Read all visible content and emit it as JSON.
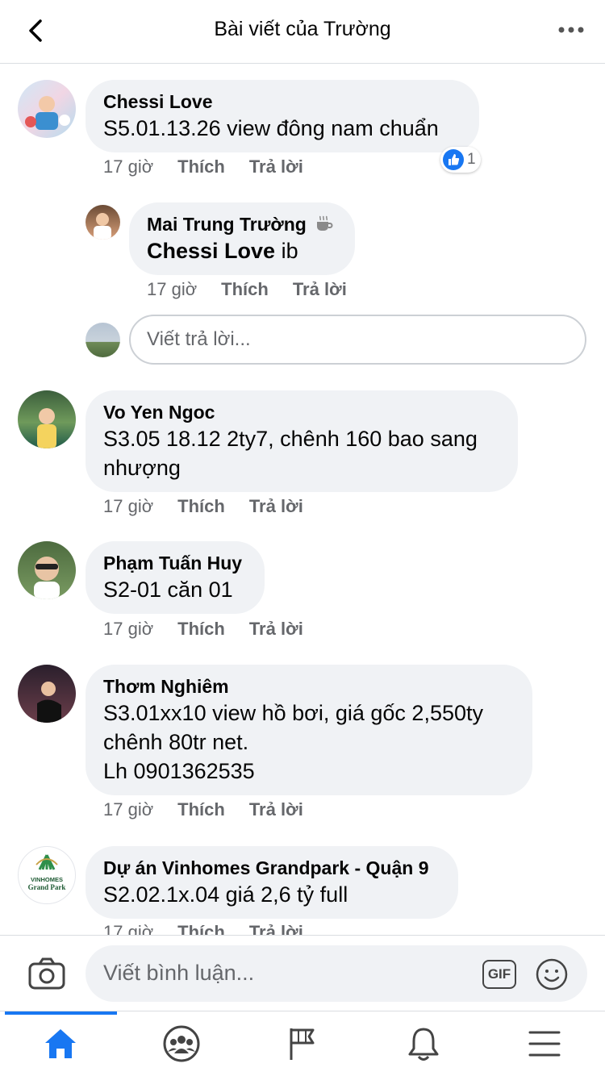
{
  "header": {
    "title": "Bài viết của Trường"
  },
  "comments": [
    {
      "name": "Chessi Love",
      "text": "S5.01.13.26 view đông nam chuẩn",
      "time": "17 giờ",
      "like": "Thích",
      "reply": "Trả lời",
      "like_count": "1"
    },
    {
      "name": "Mai Trung Trường",
      "mention": "Chessi Love",
      "text": " ib",
      "time": "17 giờ",
      "like": "Thích",
      "reply": "Trả lời"
    },
    {
      "name": "Vo Yen Ngoc",
      "text_lines": [
        "S3.05 18.12 2ty7, chênh 160 bao sang",
        "nhượng"
      ],
      "time": "17 giờ",
      "like": "Thích",
      "reply": "Trả lời"
    },
    {
      "name": "Phạm Tuấn Huy",
      "text": "S2-01 căn 01",
      "time": "17 giờ",
      "like": "Thích",
      "reply": "Trả lời"
    },
    {
      "name": "Thơm Nghiêm",
      "text_lines": [
        "S3.01xx10 view hồ bơi, giá gốc 2,550ty",
        "chênh 80tr net.",
        "Lh 0901362535"
      ],
      "time": "17 giờ",
      "like": "Thích",
      "reply": "Trả lời"
    },
    {
      "name": "Dự án Vinhomes Grandpark - Quận 9",
      "text": "S2.02.1x.04 giá 2,6 tỷ full",
      "time": "17 giờ",
      "like": "Thích",
      "reply": "Trả lời",
      "logo_text": [
        "VINHOMES",
        "Grand Park"
      ]
    }
  ],
  "reply_placeholder": "Viết trả lời...",
  "composer": {
    "placeholder": "Viết bình luận...",
    "gif_label": "GIF"
  },
  "colors": {
    "accent": "#1877f2",
    "bubble": "#f0f2f5",
    "meta": "#65676b"
  },
  "tabs": [
    "home-icon",
    "groups-icon",
    "pages-flag-icon",
    "notifications-bell-icon",
    "menu-icon"
  ]
}
